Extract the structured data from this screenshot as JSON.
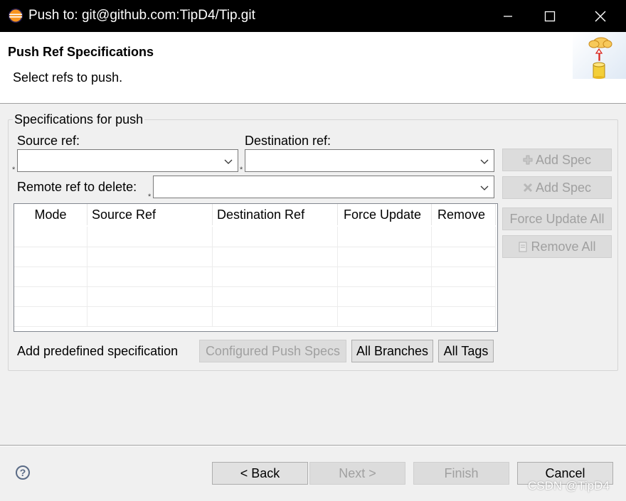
{
  "window": {
    "title": "Push to: git@github.com:TipD4/Tip.git",
    "minimize_icon": "minimize-icon",
    "maximize_icon": "maximize-icon",
    "close_icon": "close-icon"
  },
  "header": {
    "title": "Push Ref Specifications",
    "message": "Select refs to push.",
    "banner_icon": "cloud-push-database-icon"
  },
  "group": {
    "label": "Specifications for push",
    "source_ref_label": "Source ref:",
    "source_ref_value": "",
    "destination_ref_label": "Destination ref:",
    "destination_ref_value": "",
    "remote_delete_label": "Remote ref to delete:",
    "remote_delete_value": "",
    "required_marker": "*"
  },
  "side_buttons": {
    "add_spec": "Add Spec",
    "add_delete_spec": "Add Spec",
    "force_update_all": "Force Update All",
    "remove_all": "Remove All"
  },
  "table": {
    "columns": [
      "Mode",
      "Source Ref",
      "Destination Ref",
      "Force Update",
      "Remove"
    ],
    "rows": []
  },
  "predefined": {
    "label": "Add predefined specification",
    "configured_push_specs": "Configured Push Specs",
    "all_branches": "All Branches",
    "all_tags": "All Tags"
  },
  "footer": {
    "help_icon": "help-icon",
    "back": "< Back",
    "next": "Next >",
    "finish": "Finish",
    "cancel": "Cancel"
  },
  "watermark": "CSDN @TipD4",
  "colors": {
    "titlebar": "#000000",
    "header_bg": "#ffffff",
    "dialog_bg": "#f0f0f0",
    "disabled_text": "#a0a0a0"
  }
}
